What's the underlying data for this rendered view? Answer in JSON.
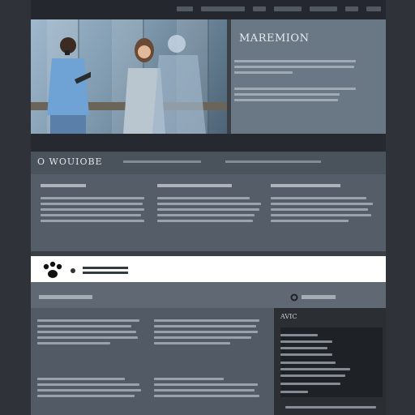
{
  "hero": {
    "title": "MAREMION"
  },
  "band": {
    "title": "O WOUIOBE"
  },
  "sidebar": {
    "label": "AVIC"
  },
  "colors": {
    "page_bg": "#2f3339",
    "top_bar": "#24282e",
    "hero_panel": "#6a7784",
    "band": "#4a525b",
    "callout_bg": "#ffffff",
    "sidebar_bg": "#2b2f34"
  },
  "icons": {
    "callout": "paw-icon",
    "section": "circle-icon"
  }
}
